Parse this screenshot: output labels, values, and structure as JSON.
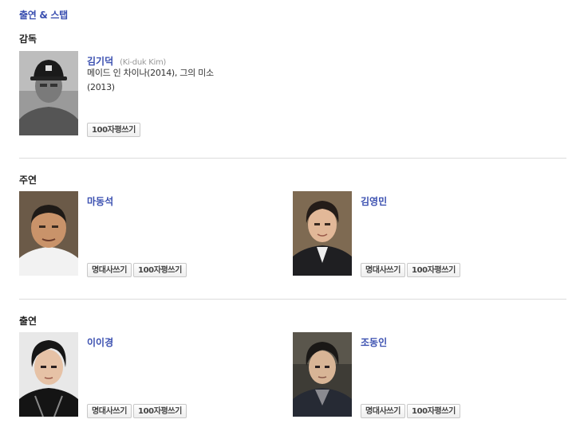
{
  "page": {
    "title": "출연 & 스탭"
  },
  "sections": {
    "director": {
      "label": "감독",
      "people": [
        {
          "name": "김기덕",
          "name_en": "(Ki-duk Kim)",
          "filmography": "메이드 인 차이나(2014), 그의 미소(2013)",
          "buttons": [
            "100자평쓰기"
          ]
        }
      ]
    },
    "lead": {
      "label": "주연",
      "people": [
        {
          "name": "마동석",
          "buttons": [
            "명대사쓰기",
            "100자평쓰기"
          ]
        },
        {
          "name": "김영민",
          "buttons": [
            "명대사쓰기",
            "100자평쓰기"
          ]
        }
      ]
    },
    "cast": {
      "label": "출연",
      "people": [
        {
          "name": "이이경",
          "buttons": [
            "명대사쓰기",
            "100자평쓰기"
          ]
        },
        {
          "name": "조동인",
          "buttons": [
            "명대사쓰기",
            "100자평쓰기"
          ]
        }
      ]
    }
  },
  "colors": {
    "accent": "#3a4fb0",
    "divider": "#dcdcdc"
  },
  "icons": {
    "photo": "person-photo-icon"
  }
}
